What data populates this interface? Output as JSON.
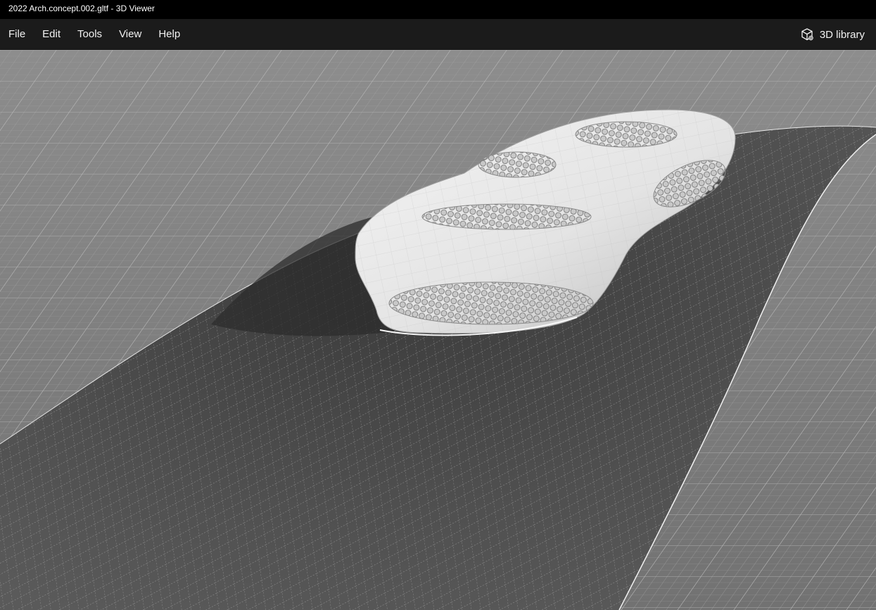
{
  "window": {
    "title": "2022 Arch.concept.002.gltf - 3D Viewer"
  },
  "menu": {
    "items": [
      {
        "label": "File"
      },
      {
        "label": "Edit"
      },
      {
        "label": "Tools"
      },
      {
        "label": "View"
      },
      {
        "label": "Help"
      }
    ],
    "library_label": "3D library",
    "library_icon": "cube-icon"
  },
  "viewport": {
    "model_name": "Arch.concept.002",
    "colors": {
      "grid_floor": "#7c7c7c",
      "grid_line": "#a9a9a9",
      "terrain": "#4a4a4a",
      "model": "#e6e6e6"
    }
  }
}
